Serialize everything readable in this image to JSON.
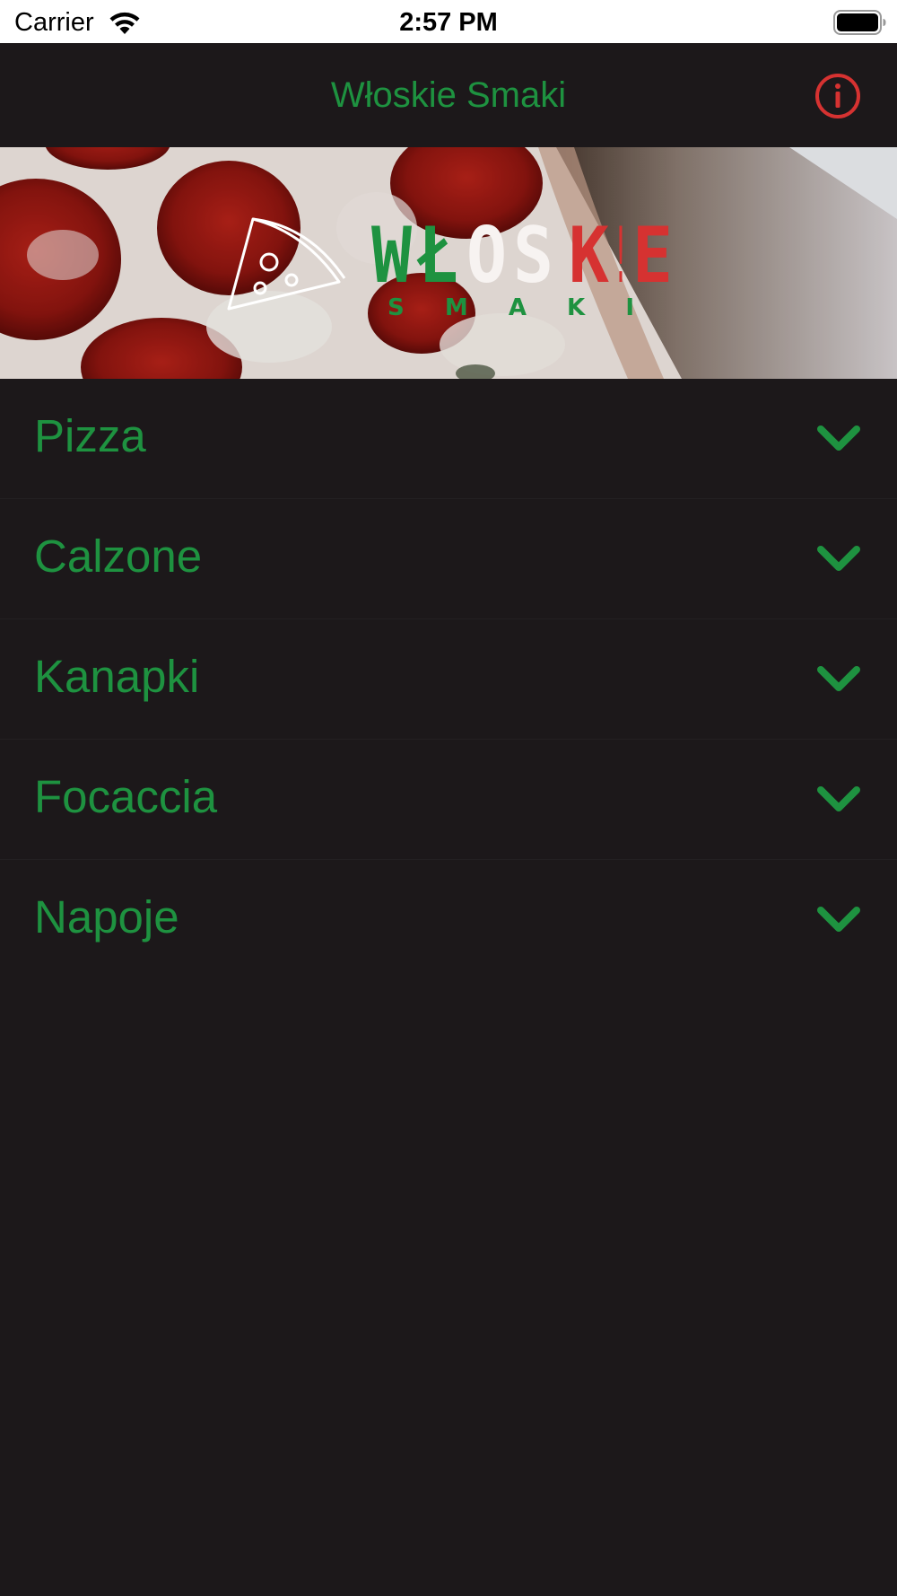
{
  "status_bar": {
    "carrier": "Carrier",
    "time": "2:57 PM"
  },
  "nav": {
    "title": "Włoskie Smaki",
    "info_icon": "info-circle-icon"
  },
  "banner": {
    "logo_letters": [
      "W",
      "Ł",
      "O",
      "S",
      "K",
      "!",
      "E"
    ],
    "logo_subtitle": "S M A K I"
  },
  "categories": [
    {
      "label": "Pizza"
    },
    {
      "label": "Calzone"
    },
    {
      "label": "Kanapki"
    },
    {
      "label": "Focaccia"
    },
    {
      "label": "Napoje"
    }
  ],
  "colors": {
    "background": "#1c181a",
    "accent_green": "#1e9240",
    "accent_red": "#d63231",
    "logo_white": "#f7f3f1"
  }
}
